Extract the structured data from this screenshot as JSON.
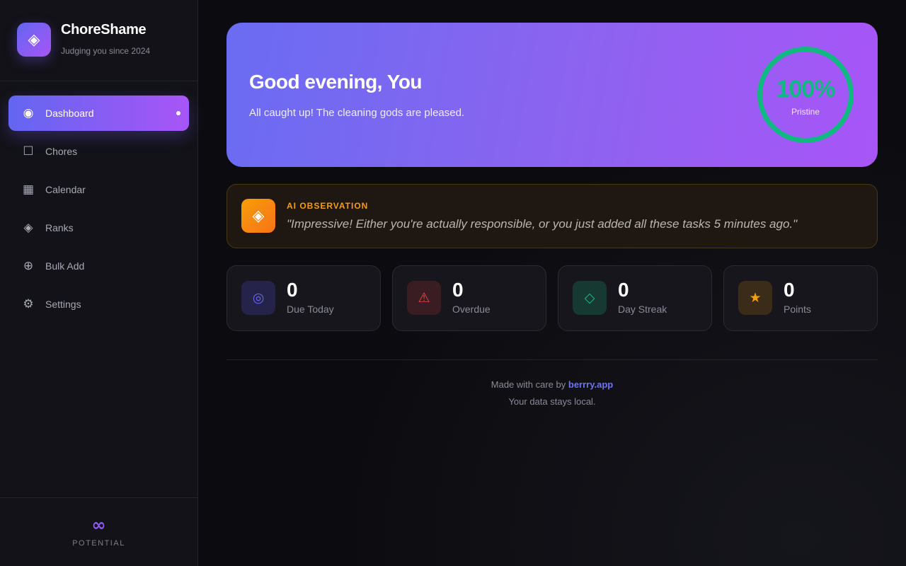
{
  "app": {
    "name": "ChoreShame",
    "tagline": "Judging you since 2024",
    "logo_icon": "diamond-icon"
  },
  "sidebar": {
    "items": [
      {
        "label": "Dashboard",
        "icon": "radio-dot-icon",
        "glyph": "◉",
        "active": true
      },
      {
        "label": "Chores",
        "icon": "checkbox-icon",
        "glyph": "☐",
        "active": false
      },
      {
        "label": "Calendar",
        "icon": "calendar-grid-icon",
        "glyph": "▦",
        "active": false
      },
      {
        "label": "Ranks",
        "icon": "diamond-icon",
        "glyph": "◈",
        "active": false
      },
      {
        "label": "Bulk Add",
        "icon": "circle-plus-icon",
        "glyph": "⊕",
        "active": false
      },
      {
        "label": "Settings",
        "icon": "gear-icon",
        "glyph": "⚙",
        "active": false
      }
    ],
    "footer": {
      "symbol": "∞",
      "label": "POTENTIAL"
    }
  },
  "hero": {
    "greeting": "Good evening, You",
    "subtitle": "All caught up! The cleaning gods are pleased.",
    "score": "100%",
    "score_label": "Pristine",
    "score_fraction": 1.0,
    "ring_color": "#10b981"
  },
  "ai": {
    "title": "AI OBSERVATION",
    "quote": "\"Impressive! Either you're actually responsible, or you just added all these tasks 5 minutes ago.\"",
    "icon": "diamond-icon",
    "accent": "#f59e0b"
  },
  "stats": [
    {
      "value": "0",
      "label": "Due Today",
      "icon": "target-icon",
      "glyph": "◎",
      "color": "#6366f1",
      "bg": "#25234a"
    },
    {
      "value": "0",
      "label": "Overdue",
      "icon": "warning-icon",
      "glyph": "⚠",
      "color": "#ef4444",
      "bg": "#3a1d22"
    },
    {
      "value": "0",
      "label": "Day Streak",
      "icon": "diamond-outline-icon",
      "glyph": "◇",
      "color": "#10b981",
      "bg": "#163a31"
    },
    {
      "value": "0",
      "label": "Points",
      "icon": "star-icon",
      "glyph": "★",
      "color": "#f59e0b",
      "bg": "#3a2c19"
    }
  ],
  "footer": {
    "prefix": "Made with care by ",
    "link": "berrry.app",
    "note": "Your data stays local."
  }
}
